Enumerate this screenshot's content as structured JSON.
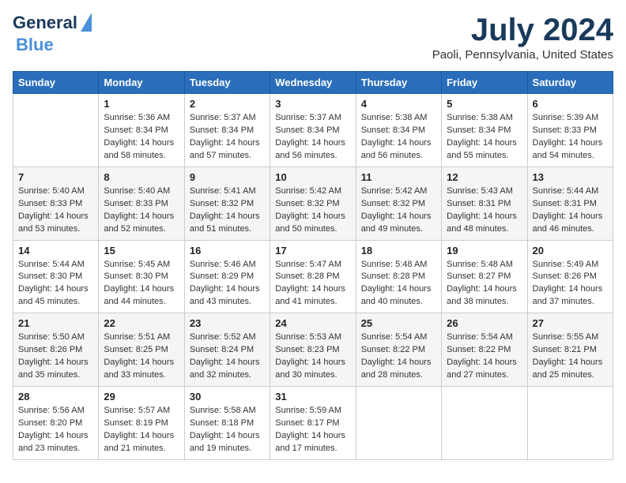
{
  "logo": {
    "text_general": "General",
    "text_blue": "Blue"
  },
  "title": "July 2024",
  "location": "Paoli, Pennsylvania, United States",
  "days_header": [
    "Sunday",
    "Monday",
    "Tuesday",
    "Wednesday",
    "Thursday",
    "Friday",
    "Saturday"
  ],
  "weeks": [
    [
      {
        "day": "",
        "info": ""
      },
      {
        "day": "1",
        "info": "Sunrise: 5:36 AM\nSunset: 8:34 PM\nDaylight: 14 hours\nand 58 minutes."
      },
      {
        "day": "2",
        "info": "Sunrise: 5:37 AM\nSunset: 8:34 PM\nDaylight: 14 hours\nand 57 minutes."
      },
      {
        "day": "3",
        "info": "Sunrise: 5:37 AM\nSunset: 8:34 PM\nDaylight: 14 hours\nand 56 minutes."
      },
      {
        "day": "4",
        "info": "Sunrise: 5:38 AM\nSunset: 8:34 PM\nDaylight: 14 hours\nand 56 minutes."
      },
      {
        "day": "5",
        "info": "Sunrise: 5:38 AM\nSunset: 8:34 PM\nDaylight: 14 hours\nand 55 minutes."
      },
      {
        "day": "6",
        "info": "Sunrise: 5:39 AM\nSunset: 8:33 PM\nDaylight: 14 hours\nand 54 minutes."
      }
    ],
    [
      {
        "day": "7",
        "info": "Sunrise: 5:40 AM\nSunset: 8:33 PM\nDaylight: 14 hours\nand 53 minutes."
      },
      {
        "day": "8",
        "info": "Sunrise: 5:40 AM\nSunset: 8:33 PM\nDaylight: 14 hours\nand 52 minutes."
      },
      {
        "day": "9",
        "info": "Sunrise: 5:41 AM\nSunset: 8:32 PM\nDaylight: 14 hours\nand 51 minutes."
      },
      {
        "day": "10",
        "info": "Sunrise: 5:42 AM\nSunset: 8:32 PM\nDaylight: 14 hours\nand 50 minutes."
      },
      {
        "day": "11",
        "info": "Sunrise: 5:42 AM\nSunset: 8:32 PM\nDaylight: 14 hours\nand 49 minutes."
      },
      {
        "day": "12",
        "info": "Sunrise: 5:43 AM\nSunset: 8:31 PM\nDaylight: 14 hours\nand 48 minutes."
      },
      {
        "day": "13",
        "info": "Sunrise: 5:44 AM\nSunset: 8:31 PM\nDaylight: 14 hours\nand 46 minutes."
      }
    ],
    [
      {
        "day": "14",
        "info": "Sunrise: 5:44 AM\nSunset: 8:30 PM\nDaylight: 14 hours\nand 45 minutes."
      },
      {
        "day": "15",
        "info": "Sunrise: 5:45 AM\nSunset: 8:30 PM\nDaylight: 14 hours\nand 44 minutes."
      },
      {
        "day": "16",
        "info": "Sunrise: 5:46 AM\nSunset: 8:29 PM\nDaylight: 14 hours\nand 43 minutes."
      },
      {
        "day": "17",
        "info": "Sunrise: 5:47 AM\nSunset: 8:28 PM\nDaylight: 14 hours\nand 41 minutes."
      },
      {
        "day": "18",
        "info": "Sunrise: 5:48 AM\nSunset: 8:28 PM\nDaylight: 14 hours\nand 40 minutes."
      },
      {
        "day": "19",
        "info": "Sunrise: 5:48 AM\nSunset: 8:27 PM\nDaylight: 14 hours\nand 38 minutes."
      },
      {
        "day": "20",
        "info": "Sunrise: 5:49 AM\nSunset: 8:26 PM\nDaylight: 14 hours\nand 37 minutes."
      }
    ],
    [
      {
        "day": "21",
        "info": "Sunrise: 5:50 AM\nSunset: 8:26 PM\nDaylight: 14 hours\nand 35 minutes."
      },
      {
        "day": "22",
        "info": "Sunrise: 5:51 AM\nSunset: 8:25 PM\nDaylight: 14 hours\nand 33 minutes."
      },
      {
        "day": "23",
        "info": "Sunrise: 5:52 AM\nSunset: 8:24 PM\nDaylight: 14 hours\nand 32 minutes."
      },
      {
        "day": "24",
        "info": "Sunrise: 5:53 AM\nSunset: 8:23 PM\nDaylight: 14 hours\nand 30 minutes."
      },
      {
        "day": "25",
        "info": "Sunrise: 5:54 AM\nSunset: 8:22 PM\nDaylight: 14 hours\nand 28 minutes."
      },
      {
        "day": "26",
        "info": "Sunrise: 5:54 AM\nSunset: 8:22 PM\nDaylight: 14 hours\nand 27 minutes."
      },
      {
        "day": "27",
        "info": "Sunrise: 5:55 AM\nSunset: 8:21 PM\nDaylight: 14 hours\nand 25 minutes."
      }
    ],
    [
      {
        "day": "28",
        "info": "Sunrise: 5:56 AM\nSunset: 8:20 PM\nDaylight: 14 hours\nand 23 minutes."
      },
      {
        "day": "29",
        "info": "Sunrise: 5:57 AM\nSunset: 8:19 PM\nDaylight: 14 hours\nand 21 minutes."
      },
      {
        "day": "30",
        "info": "Sunrise: 5:58 AM\nSunset: 8:18 PM\nDaylight: 14 hours\nand 19 minutes."
      },
      {
        "day": "31",
        "info": "Sunrise: 5:59 AM\nSunset: 8:17 PM\nDaylight: 14 hours\nand 17 minutes."
      },
      {
        "day": "",
        "info": ""
      },
      {
        "day": "",
        "info": ""
      },
      {
        "day": "",
        "info": ""
      }
    ]
  ]
}
